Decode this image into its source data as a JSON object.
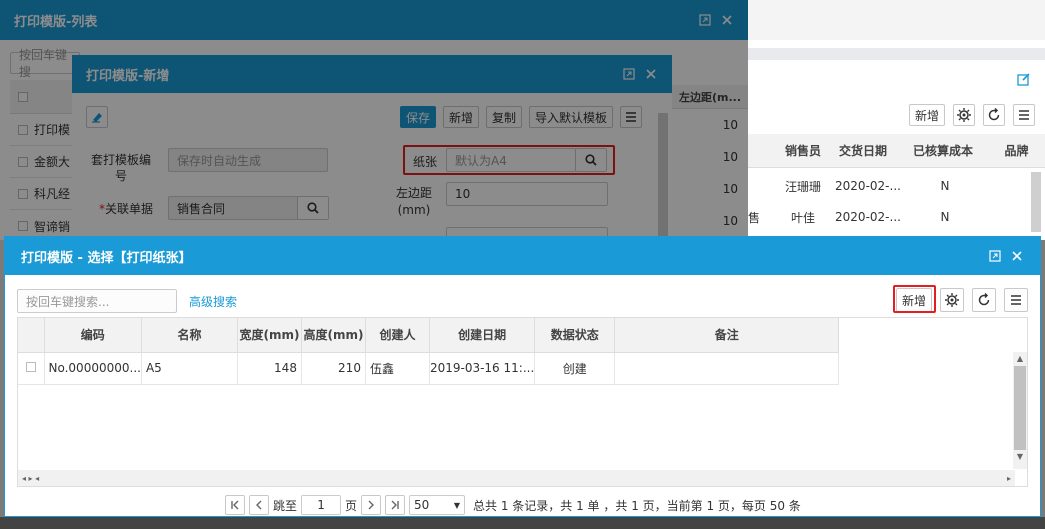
{
  "bg_window": {
    "title": "打印模版-列表",
    "search_placeholder": "按回车键搜",
    "rows": [
      "打印模",
      "金额大",
      "科凡经",
      "智谛销"
    ]
  },
  "right_panel": {
    "add_label": "新增",
    "columns": [
      "销售员",
      "交货日期",
      "已核算成本",
      "品牌"
    ],
    "rows": [
      {
        "partial": "",
        "seller": "汪珊珊",
        "date": "2020-02-...",
        "costed": "N"
      },
      {
        "partial": "售",
        "seller": "叶佳",
        "date": "2020-02-...",
        "costed": "N"
      }
    ]
  },
  "mid_window": {
    "title": "打印模版-新增",
    "toolbar": {
      "save": "保存",
      "add": "新增",
      "copy": "复制",
      "import": "导入默认模板"
    },
    "fields": {
      "template_no_label": "套打模板编号",
      "template_no_placeholder": "保存时自动生成",
      "paper_label": "纸张",
      "paper_placeholder": "默认为A4",
      "related_doc_label": "关联单据",
      "related_doc_required": "*",
      "related_doc_value": "销售合同",
      "left_margin_label": "左边距(mm)",
      "left_margin_value": "10"
    },
    "side_column_header": "左边距(m...",
    "side_values": [
      "10",
      "10",
      "10",
      "10"
    ]
  },
  "dialog": {
    "title": "打印模版 - 选择【打印纸张】",
    "search_placeholder": "按回车键搜索...",
    "advanced_search": "高级搜索",
    "add_label": "新增",
    "columns": [
      "编码",
      "名称",
      "宽度(mm)",
      "高度(mm)",
      "创建人",
      "创建日期",
      "数据状态",
      "备注"
    ],
    "rows": [
      {
        "code": "No.00000000...",
        "name": "A5",
        "width": "148",
        "height": "210",
        "creator": "伍鑫",
        "created": "2019-03-16 11:...",
        "status": "创建",
        "note": ""
      }
    ],
    "pager": {
      "goto": "跳至",
      "page_value": "1",
      "page_unit": "页",
      "page_size": "50",
      "summary": "总共 1 条记录，共 1 单 ，共 1 页，当前第 1 页，每页 50 条"
    }
  }
}
